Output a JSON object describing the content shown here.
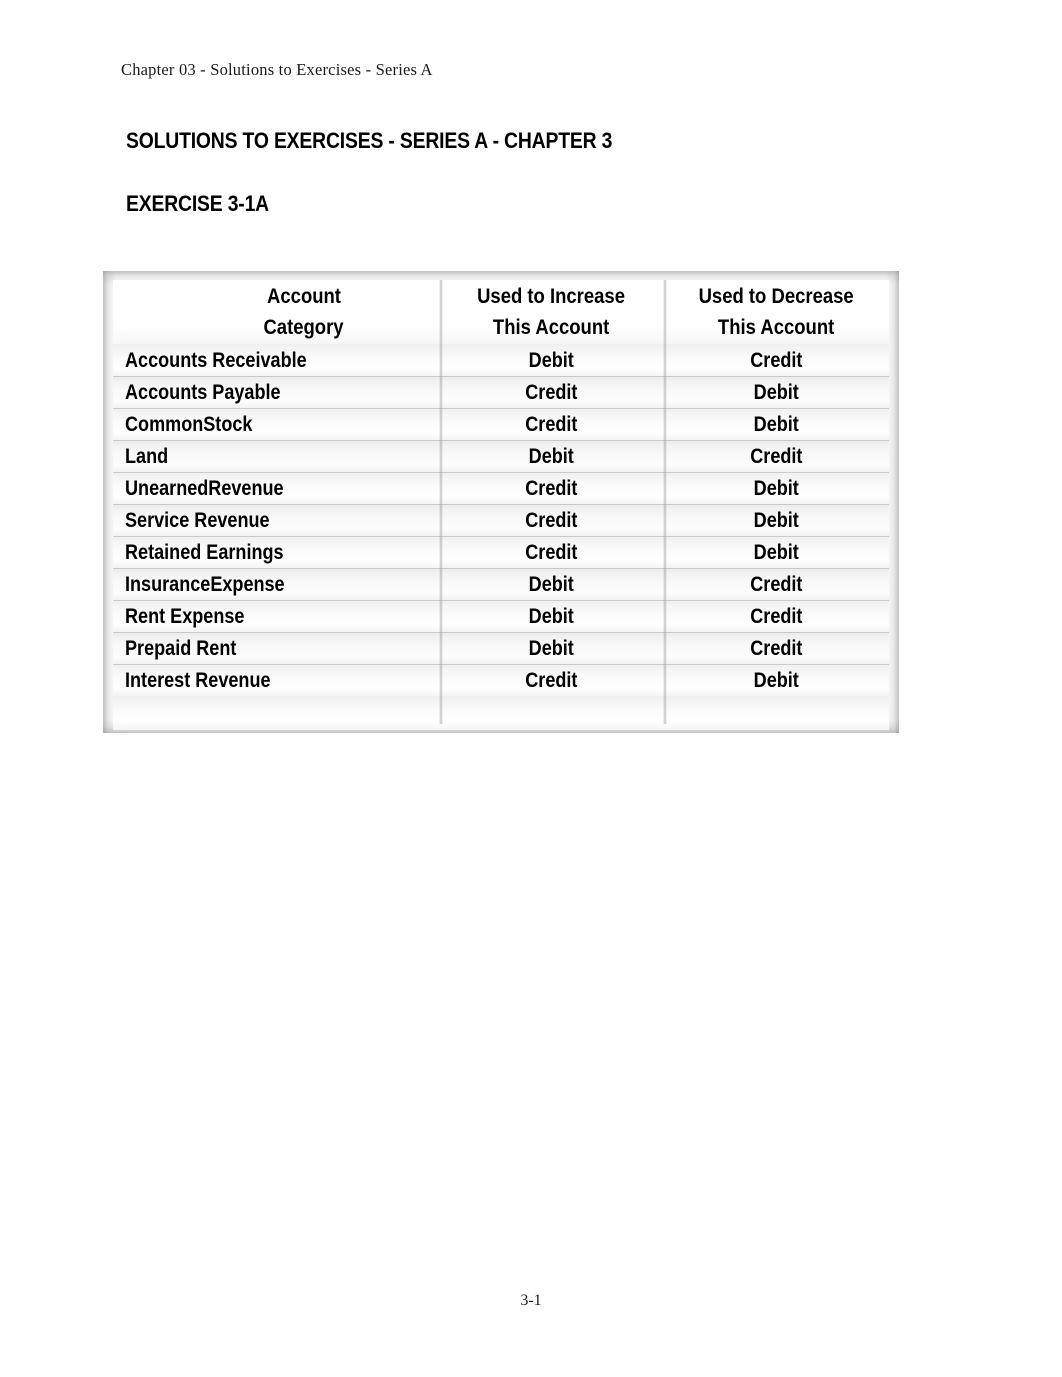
{
  "document": {
    "running_header": "Chapter 03 - Solutions to Exercises - Series A",
    "title": "SOLUTIONS TO EXERCISES - SERIES A - CHAPTER 3",
    "exercise_heading": "EXERCISE 3-1A",
    "page_number": "3-1",
    "colors": {
      "text": "#000000",
      "header_text": "#1a1a1a",
      "page_background": "#ffffff",
      "table_border": "#8c8c8c",
      "row_shade": "#f0f0f0",
      "row_divider": "#aaaaaa"
    }
  },
  "table": {
    "headers": {
      "account": {
        "line1": "Account",
        "line2": "Category"
      },
      "increase": {
        "line1": "Used to Increase",
        "line2": "This Account"
      },
      "decrease": {
        "line1": "Used to Decrease",
        "line2": "This Account"
      }
    },
    "rows": [
      {
        "account": "Accounts Receivable",
        "increase": "Debit",
        "decrease": "Credit"
      },
      {
        "account": "Accounts Payable",
        "increase": "Credit",
        "decrease": "Debit"
      },
      {
        "account": "CommonStock",
        "increase": "Credit",
        "decrease": "Debit"
      },
      {
        "account": "Land",
        "increase": "Debit",
        "decrease": "Credit"
      },
      {
        "account": "UnearnedRevenue",
        "increase": "Credit",
        "decrease": "Debit"
      },
      {
        "account": "Service Revenue",
        "increase": "Credit",
        "decrease": "Debit"
      },
      {
        "account": "Retained Earnings",
        "increase": "Credit",
        "decrease": "Debit"
      },
      {
        "account": "InsuranceExpense",
        "increase": "Debit",
        "decrease": "Credit"
      },
      {
        "account": "Rent Expense",
        "increase": "Debit",
        "decrease": "Credit"
      },
      {
        "account": "Prepaid Rent",
        "increase": "Debit",
        "decrease": "Credit"
      },
      {
        "account": "Interest Revenue",
        "increase": "Credit",
        "decrease": "Debit"
      }
    ]
  }
}
